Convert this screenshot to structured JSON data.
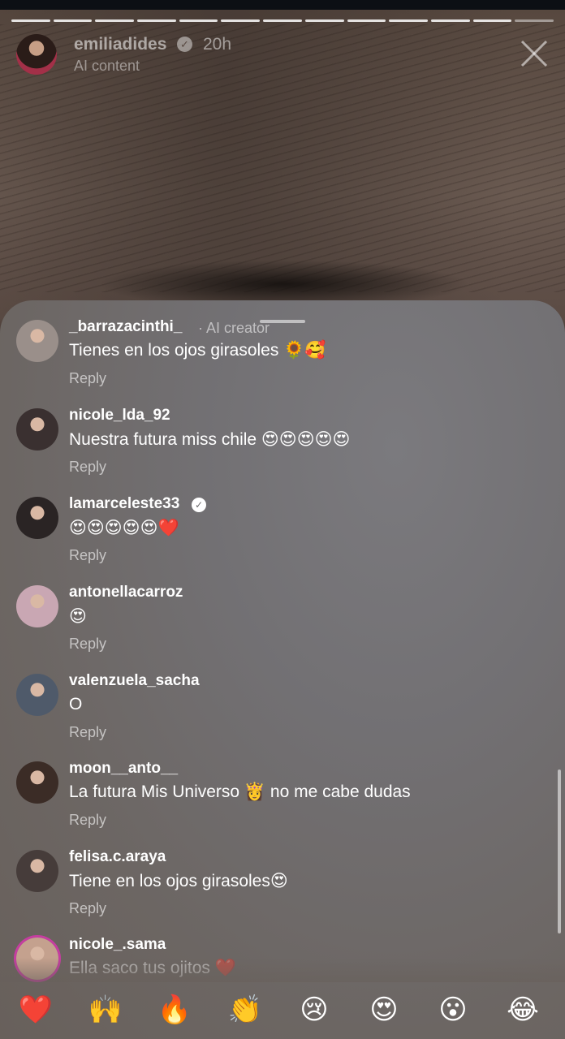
{
  "story": {
    "username": "emiliadides",
    "time": "20h",
    "subtitle": "AI content",
    "verified_icon": "verified-badge-icon",
    "close_icon": "close-icon",
    "segments": 13
  },
  "comments": [
    {
      "user": "_barrazacinthi_",
      "tag": "· AI creator",
      "text": "Tienes en los ojos girasoles 🌻🥰",
      "reply": "Reply",
      "verified": false,
      "avatar_color": "#9a8f8a"
    },
    {
      "user": "nicole_lda_92",
      "tag": "",
      "text": "Nuestra futura miss chile 😍😍😍😍😍",
      "reply": "Reply",
      "verified": false,
      "avatar_color": "#3a3030"
    },
    {
      "user": "lamarceleste33",
      "tag": "",
      "text": "😍😍😍😍😍❤️",
      "reply": "Reply",
      "verified": true,
      "avatar_color": "#2a2424"
    },
    {
      "user": "antonellacarroz",
      "tag": "",
      "text": "😍",
      "reply": "Reply",
      "verified": false,
      "avatar_color": "#c9a7b3"
    },
    {
      "user": "valenzuela_sacha",
      "tag": "",
      "text": "O",
      "reply": "Reply",
      "verified": false,
      "avatar_color": "#4f5a6a"
    },
    {
      "user": "moon__anto__",
      "tag": "",
      "text": "La futura Mis Universo 👸 no me cabe dudas",
      "reply": "Reply",
      "verified": false,
      "avatar_color": "#3b2c26"
    },
    {
      "user": "felisa.c.araya",
      "tag": "",
      "text": "Tiene en los ojos girasoles😍",
      "reply": "Reply",
      "verified": false,
      "avatar_color": "#463c3a"
    },
    {
      "user": "nicole_.sama",
      "tag": "",
      "text": "Ella saco tus ojitos ❤️",
      "reply": "",
      "verified": false,
      "avatar_color": "#c4a18e"
    }
  ],
  "reactions": [
    "❤️",
    "🙌",
    "🔥",
    "👏",
    "😢",
    "😍",
    "😮",
    "😂"
  ],
  "reaction_names": [
    "heart-reaction",
    "raised-hands-reaction",
    "fire-reaction",
    "clap-reaction",
    "crying-reaction",
    "heart-eyes-reaction",
    "surprised-reaction",
    "laughing-reaction"
  ]
}
